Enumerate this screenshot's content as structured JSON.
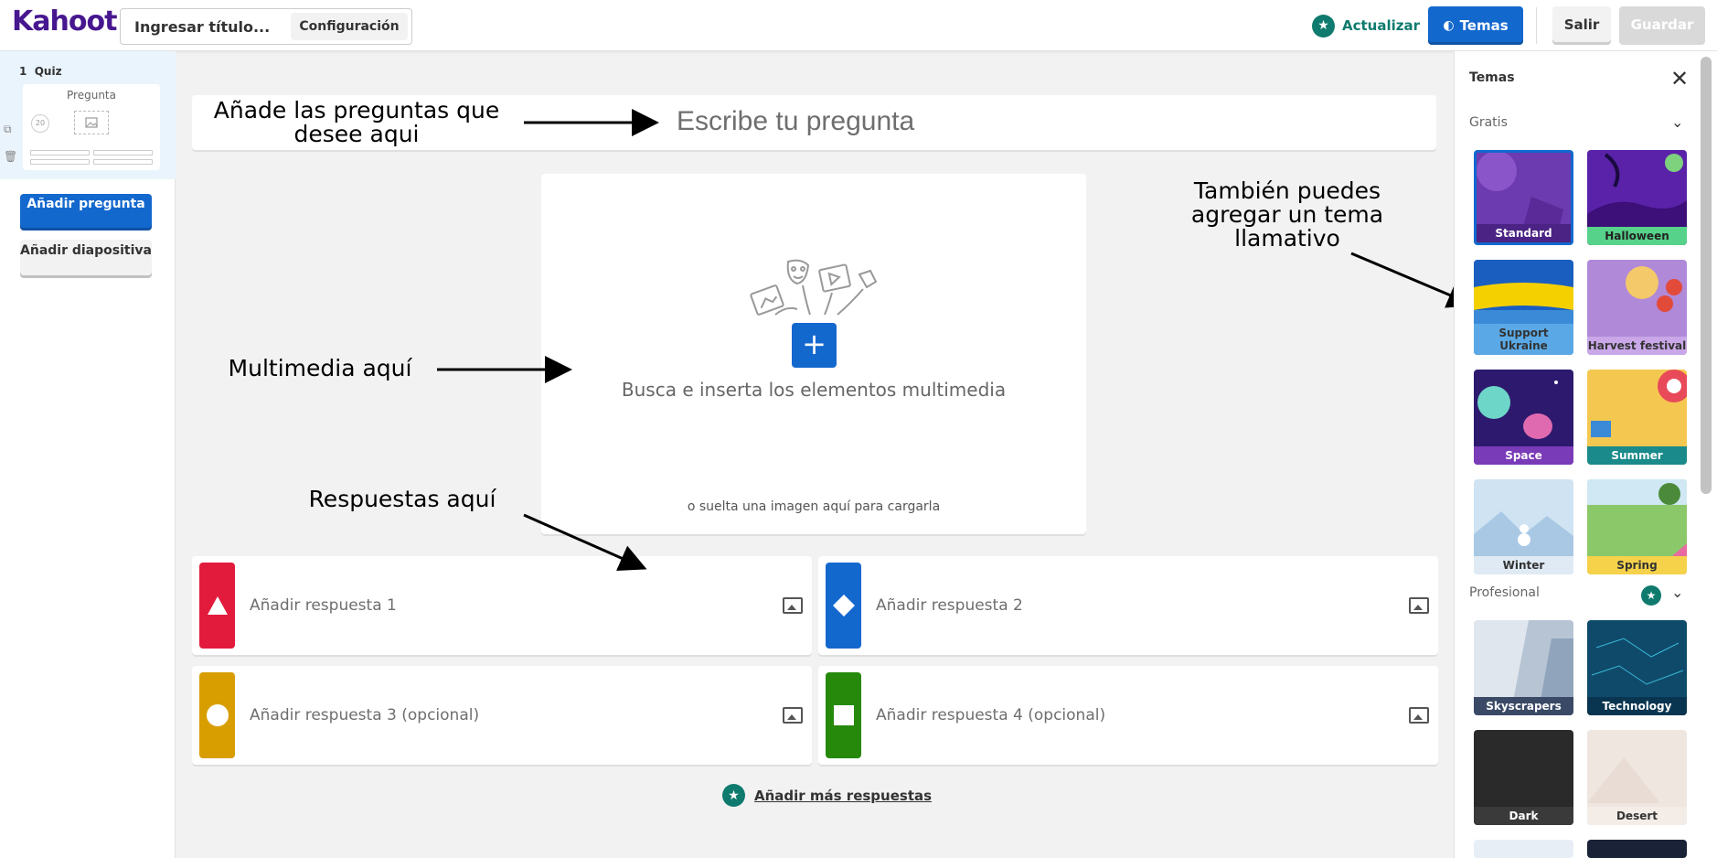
{
  "header": {
    "logo": "Kahoot!",
    "title_placeholder": "Ingresar título...",
    "config_label": "Configuración",
    "upgrade_label": "Actualizar",
    "themes_label": "Temas",
    "exit_label": "Salir",
    "save_label": "Guardar"
  },
  "sidebar": {
    "slide_number": "1",
    "slide_type": "Quiz",
    "thumb_title": "Pregunta",
    "thumb_timer": "20",
    "add_question": "Añadir pregunta",
    "add_slide": "Añadir diapositiva"
  },
  "editor": {
    "question_placeholder": "Escribe tu pregunta",
    "media_text": "Busca e inserta los elementos multimedia",
    "media_sub": "o suelta una imagen aquí para cargarla",
    "answers": [
      {
        "label": "Añadir respuesta 1",
        "color": "#e21b3c",
        "shape": "triangle"
      },
      {
        "label": "Añadir respuesta 2",
        "color": "#1368ce",
        "shape": "diamond"
      },
      {
        "label": "Añadir respuesta 3 (opcional)",
        "color": "#d89e00",
        "shape": "circle"
      },
      {
        "label": "Añadir respuesta 4 (opcional)",
        "color": "#26890c",
        "shape": "square"
      }
    ],
    "more_answers": "Añadir más respuestas"
  },
  "annotations": {
    "questions": "Añade las preguntas que desee aqui",
    "multimedia": "Multimedia aquí",
    "answers": "Respuestas aquí",
    "themes": "También puedes agregar un tema llamativo"
  },
  "themes_panel": {
    "title": "Temas",
    "free_section": "Gratis",
    "pro_section": "Profesional",
    "free_themes": [
      {
        "name": "Standard",
        "bg": "#6d3bb0",
        "label_bg": "#4a2384",
        "selected": true
      },
      {
        "name": "Halloween",
        "bg": "#5a22a8",
        "label_bg": "#56d28a",
        "label_color": "#222"
      },
      {
        "name": "Support Ukraine",
        "bg": "#1a5fc0",
        "label_bg": "#5aa9e6",
        "label_color": "#333"
      },
      {
        "name": "Harvest festival",
        "bg": "#b089d8",
        "label_bg": "#c9a7e8",
        "label_color": "#333"
      },
      {
        "name": "Space",
        "bg": "#2d1a6e",
        "label_bg": "#7a3bb8"
      },
      {
        "name": "Summer",
        "bg": "#f4c850",
        "label_bg": "#1a8a8a"
      },
      {
        "name": "Winter",
        "bg": "#cfe3f2",
        "label_bg": "#dfeaf4",
        "label_color": "#333"
      },
      {
        "name": "Spring",
        "bg": "#8bc86a",
        "label_bg": "#f5d24a",
        "label_color": "#333"
      }
    ],
    "pro_themes": [
      {
        "name": "Skyscrapers",
        "bg": "#dfe6ee",
        "label_bg": "#3a4a66"
      },
      {
        "name": "Technology",
        "bg": "#0f4a6a",
        "label_bg": "#0a3550"
      },
      {
        "name": "Dark",
        "bg": "#2a2a2a",
        "label_bg": "#3a3a3a"
      },
      {
        "name": "Desert",
        "bg": "#f0e6e0",
        "label_bg": "#f3ece7",
        "label_color": "#333"
      }
    ]
  }
}
